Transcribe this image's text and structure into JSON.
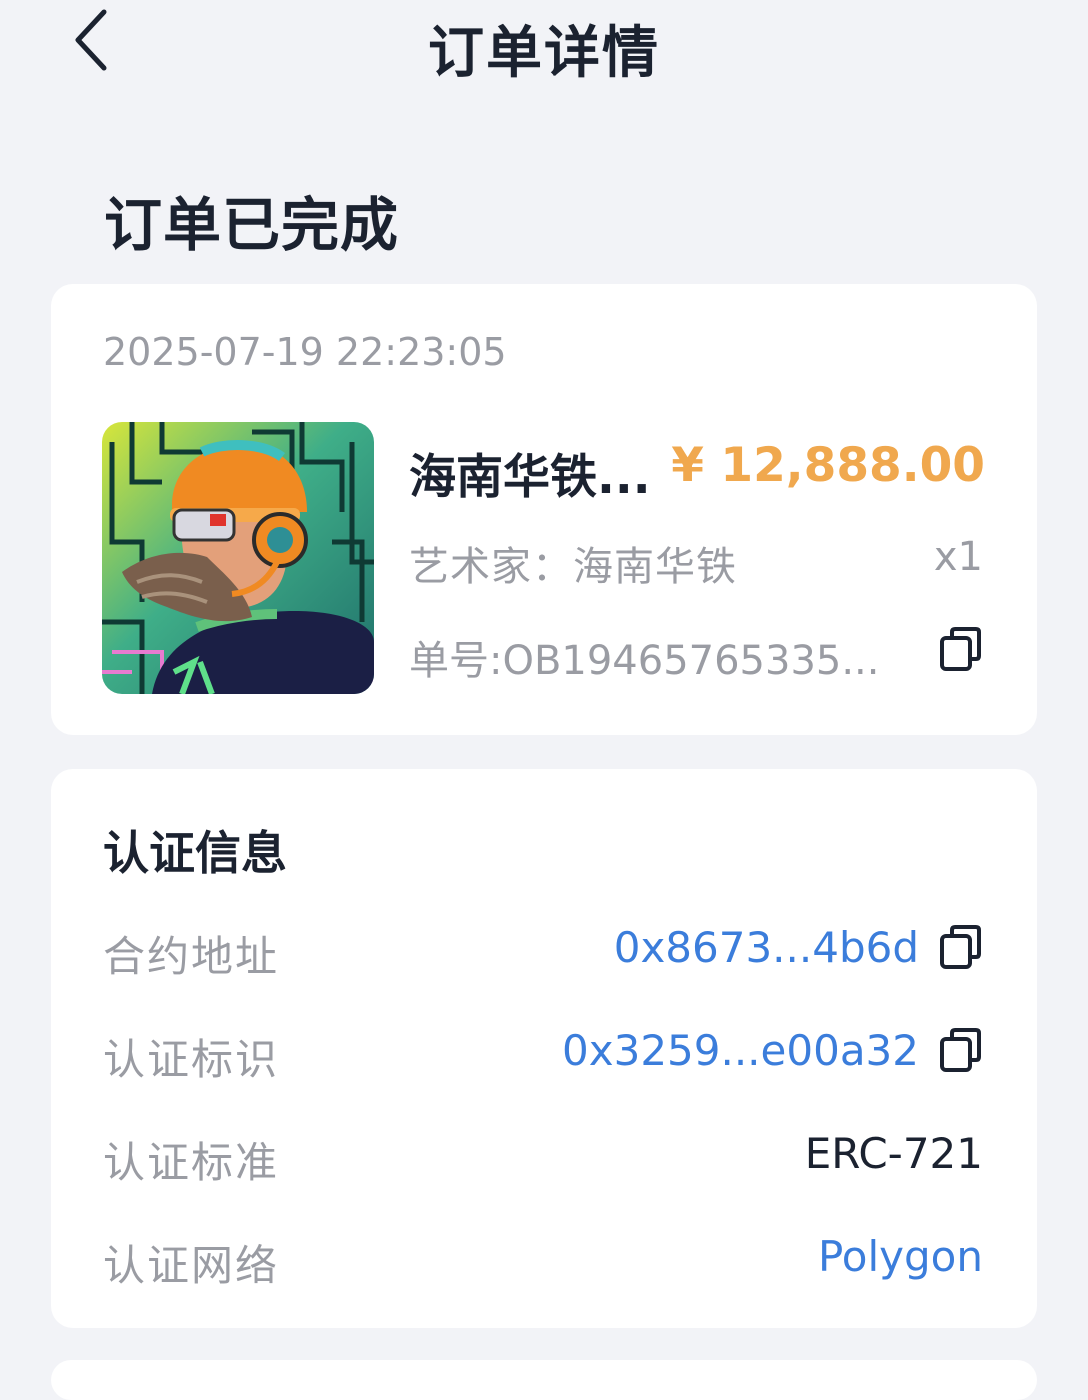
{
  "nav": {
    "title": "订单详情"
  },
  "order": {
    "status": "订单已完成",
    "time": "2025-07-19 22:23:05",
    "product_name": "海南华铁...",
    "price": "¥ 12,888.00",
    "artist": "艺术家：海南华铁",
    "quantity": "x1",
    "order_no": "单号:OB19465765335..."
  },
  "cert": {
    "title": "认证信息",
    "rows": [
      {
        "label": "合约地址",
        "value": "0x8673...4b6d"
      },
      {
        "label": "认证标识",
        "value": "0x3259...e00a32"
      },
      {
        "label": "认证标准",
        "value": "ERC-721"
      },
      {
        "label": "认证网络",
        "value": "Polygon"
      }
    ]
  },
  "colors": {
    "price": "#f0a84e",
    "link": "#3b7ddb",
    "background": "#f2f3f7"
  },
  "icons": [
    "chevron-left-icon",
    "copy-icon"
  ]
}
